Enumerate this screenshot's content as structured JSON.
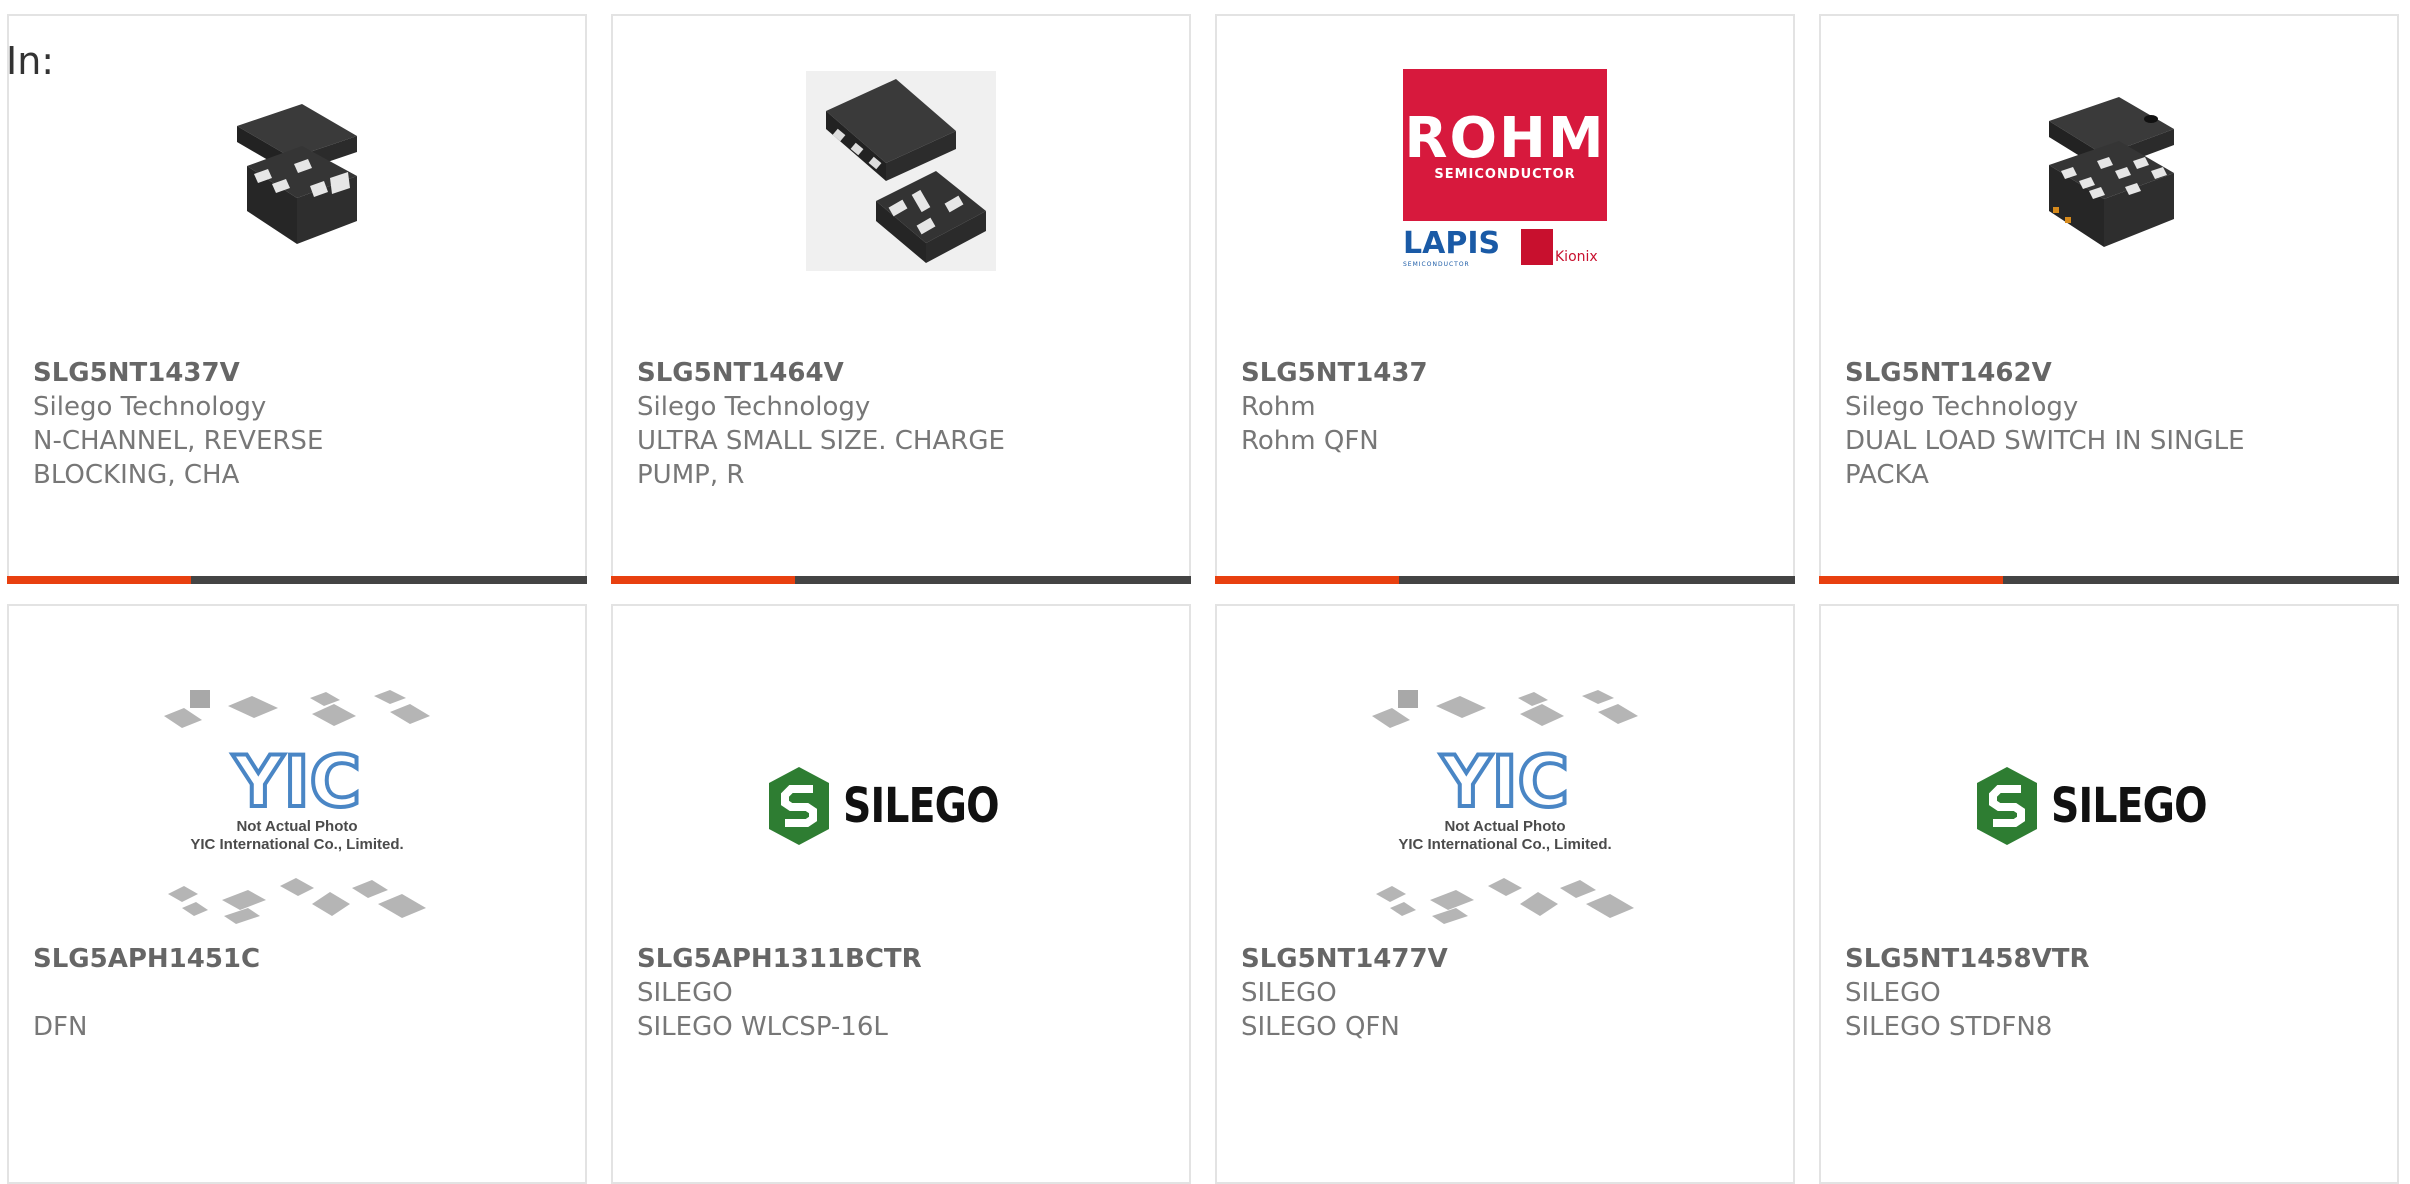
{
  "page": {
    "label": "In:"
  },
  "products": [
    {
      "part_number": "SLG5NT1437V",
      "manufacturer": "Silego Technology",
      "description_line1": "N-CHANNEL, REVERSE",
      "description_line2": "BLOCKING, CHA",
      "image": "dfn-chip-package"
    },
    {
      "part_number": "SLG5NT1464V",
      "manufacturer": "Silego Technology",
      "description_line1": "ULTRA SMALL SIZE. CHARGE",
      "description_line2": "PUMP, R",
      "image": "qfn-chip-package"
    },
    {
      "part_number": "SLG5NT1437",
      "manufacturer": "Rohm",
      "description_line1": "Rohm QFN",
      "description_line2": "",
      "image": "rohm-logo",
      "logo": {
        "brand": "ROHM",
        "brand_sub": "SEMICONDUCTOR",
        "secondary": "LAPIS",
        "secondary_sub": "SEMICONDUCTOR",
        "tertiary": "Kionix"
      }
    },
    {
      "part_number": "SLG5NT1462V",
      "manufacturer": "Silego Technology",
      "description_line1": "DUAL LOAD SWITCH IN SINGLE",
      "description_line2": "PACKA",
      "image": "dfn-chip-package"
    },
    {
      "part_number": "SLG5APH1451C",
      "manufacturer": "",
      "description_line1": "DFN",
      "description_line2": "",
      "image": "not-actual-photo",
      "placeholder_line1": "Not Actual Photo",
      "placeholder_line2": "YIC International Co., Limited."
    },
    {
      "part_number": "SLG5APH1311BCTR",
      "manufacturer": "SILEGO",
      "description_line1": "SILEGO WLCSP-16L",
      "description_line2": "",
      "image": "silego-logo",
      "logo_text": "SILEGO"
    },
    {
      "part_number": "SLG5NT1477V",
      "manufacturer": "SILEGO",
      "description_line1": "SILEGO QFN",
      "description_line2": "",
      "image": "not-actual-photo",
      "placeholder_line1": "Not Actual Photo",
      "placeholder_line2": "YIC International Co., Limited."
    },
    {
      "part_number": "SLG5NT1458VTR",
      "manufacturer": "SILEGO",
      "description_line1": "SILEGO STDFN8",
      "description_line2": "",
      "image": "silego-logo",
      "logo_text": "SILEGO"
    }
  ],
  "colors": {
    "accent": "#e8400f",
    "bar": "#444444",
    "card_border": "#e3e3e3",
    "text_muted": "#777777",
    "rohm_red": "#d7193d",
    "silego_green": "#2e7d32"
  }
}
